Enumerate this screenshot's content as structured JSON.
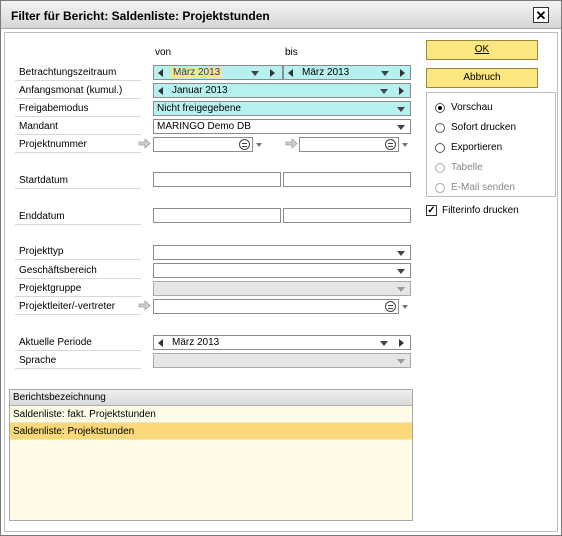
{
  "window": {
    "title": "Filter für Bericht: Saldenliste: Projektstunden"
  },
  "columns": {
    "from": "von",
    "to": "bis"
  },
  "fields": {
    "betrachtungszeitraum": {
      "label": "Betrachtungszeitraum",
      "from": "März 2013",
      "to": "März 2013"
    },
    "anfangsmonat": {
      "label": "Anfangsmonat (kumul.)",
      "value": "Januar 2013"
    },
    "freigabemodus": {
      "label": "Freigabemodus",
      "value": "Nicht freigegebene"
    },
    "mandant": {
      "label": "Mandant",
      "value": "MARINGO Demo DB"
    },
    "projektnummer": {
      "label": "Projektnummer",
      "from": "",
      "to": ""
    },
    "startdatum": {
      "label": "Startdatum",
      "from": "",
      "to": ""
    },
    "enddatum": {
      "label": "Enddatum",
      "from": "",
      "to": ""
    },
    "projekttyp": {
      "label": "Projekttyp",
      "value": ""
    },
    "geschaeftsbereich": {
      "label": "Geschäftsbereich",
      "value": ""
    },
    "projektgruppe": {
      "label": "Projektgruppe",
      "value": ""
    },
    "projektleiter": {
      "label": "Projektleiter/-vertreter",
      "value": ""
    },
    "aktuelle_periode": {
      "label": "Aktuelle Periode",
      "value": "März 2013"
    },
    "sprache": {
      "label": "Sprache",
      "value": ""
    }
  },
  "buttons": {
    "ok": "OK",
    "cancel": "Abbruch"
  },
  "output": {
    "options": [
      "Vorschau",
      "Sofort drucken",
      "Exportieren",
      "Tabelle",
      "E-Mail senden"
    ],
    "selected": "Vorschau"
  },
  "filterinfo": {
    "label": "Filterinfo drucken",
    "checked": true
  },
  "report_list": {
    "header": "Berichtsbezeichnung",
    "rows": [
      "Saldenliste: fakt. Projektstunden",
      "Saldenliste: Projektstunden"
    ],
    "selected_index": 1
  },
  "colors": {
    "highlight_yellow": "#fbe872",
    "mandatory_cyan": "#b7f1ef",
    "button_yellow": "#fbe67f",
    "row_selected": "#fbd97a"
  }
}
